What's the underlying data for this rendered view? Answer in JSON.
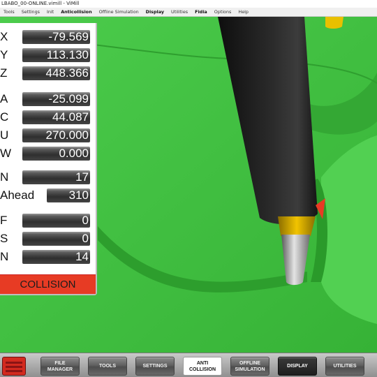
{
  "window": {
    "title": "LBABO_00-ONLINE.vimill - ViMill"
  },
  "menu": {
    "items": [
      {
        "label": "Tools",
        "strong": false
      },
      {
        "label": "Settings",
        "strong": false
      },
      {
        "label": "Init",
        "strong": false
      },
      {
        "label": "Anticollision",
        "strong": true
      },
      {
        "label": "Offline Simulation",
        "strong": false
      },
      {
        "label": "Display",
        "strong": true
      },
      {
        "label": "Utilities",
        "strong": false
      },
      {
        "label": "Fidia",
        "strong": true
      },
      {
        "label": "Options",
        "strong": false
      },
      {
        "label": "Help",
        "strong": false
      }
    ]
  },
  "dro": {
    "rows": [
      {
        "axis": "X",
        "value": "-79.569"
      },
      {
        "axis": "Y",
        "value": "113.130"
      },
      {
        "axis": "Z",
        "value": "448.366"
      },
      {
        "axis": "A",
        "value": "-25.099"
      },
      {
        "axis": "C",
        "value": "44.087"
      },
      {
        "axis": "U",
        "value": "270.000"
      },
      {
        "axis": "W",
        "value": "0.000"
      },
      {
        "axis": "N",
        "value": "17"
      },
      {
        "axis": "Ahead",
        "value": "310"
      },
      {
        "axis": "F",
        "value": "0"
      },
      {
        "axis": "S",
        "value": "0"
      },
      {
        "axis": "N",
        "value": "14"
      }
    ],
    "status": "COLLISION",
    "status_color": "#e73b24"
  },
  "toolbar": {
    "buttons": [
      {
        "label": "FILE\nMANAGER",
        "state": "normal"
      },
      {
        "label": "TOOLS",
        "state": "normal"
      },
      {
        "label": "SETTINGS",
        "state": "normal"
      },
      {
        "label": "ANTI\nCOLLISION",
        "state": "active"
      },
      {
        "label": "OFFLINE\nSIMULATION",
        "state": "normal"
      },
      {
        "label": "DISPLAY",
        "state": "dark"
      },
      {
        "label": "UTILITIES",
        "state": "normal"
      }
    ],
    "home_icon": "fidia-logo-icon"
  },
  "colors": {
    "workpiece": "#3fbf3f",
    "spindle": "#1a1a1a",
    "tool_holder": "#e0b400",
    "collision": "#e73b24"
  }
}
